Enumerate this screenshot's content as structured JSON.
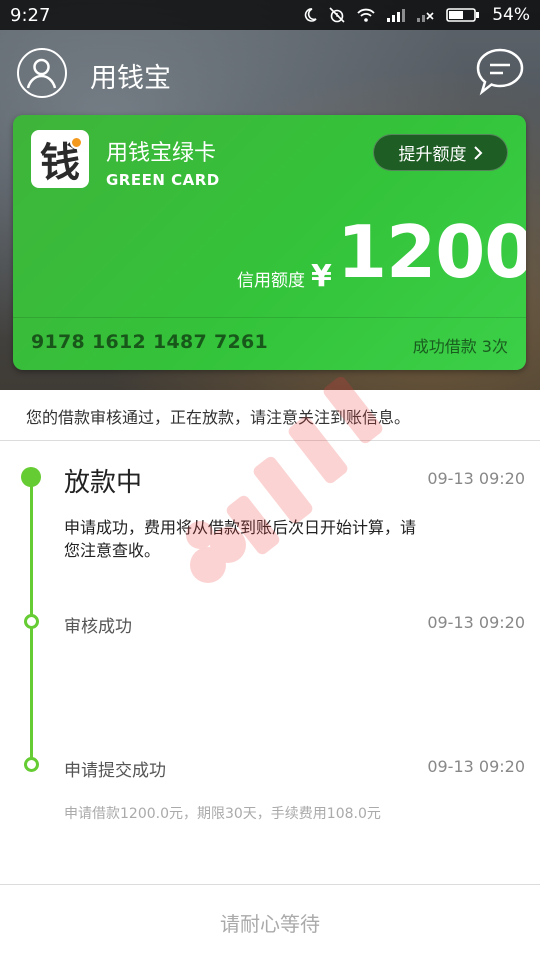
{
  "status_bar": {
    "time": "9:27",
    "battery": "54%"
  },
  "app_bar": {
    "title": "用钱宝",
    "icons": [
      "avatar-icon",
      "message-icon"
    ]
  },
  "card": {
    "logo_glyph": "钱",
    "name": "用钱宝绿卡",
    "subtitle": "GREEN CARD",
    "raise_button": "提升额度",
    "credit_label": "信用额度",
    "currency": "¥",
    "credit_amount": "1200",
    "card_number": "9178 1612 1487 7261",
    "success_count": "成功借款 3次",
    "color": "#35c03a"
  },
  "notice": "您的借款审核通过，正在放款，请注意关注到账信息。",
  "timeline": {
    "accent": "#66cc33",
    "steps": [
      {
        "title": "放款中",
        "time": "09-13 09:20",
        "desc": "申请成功，费用将从借款到账后次日开始计算，请您注意查收。"
      },
      {
        "title": "审核成功",
        "time": "09-13 09:20"
      },
      {
        "title": "申请提交成功",
        "time": "09-13 09:20"
      }
    ],
    "loan_info": "申请借款1200.0元，期限30天，手续费用108.0元"
  },
  "bottom": {
    "label": "请耐心等待"
  }
}
